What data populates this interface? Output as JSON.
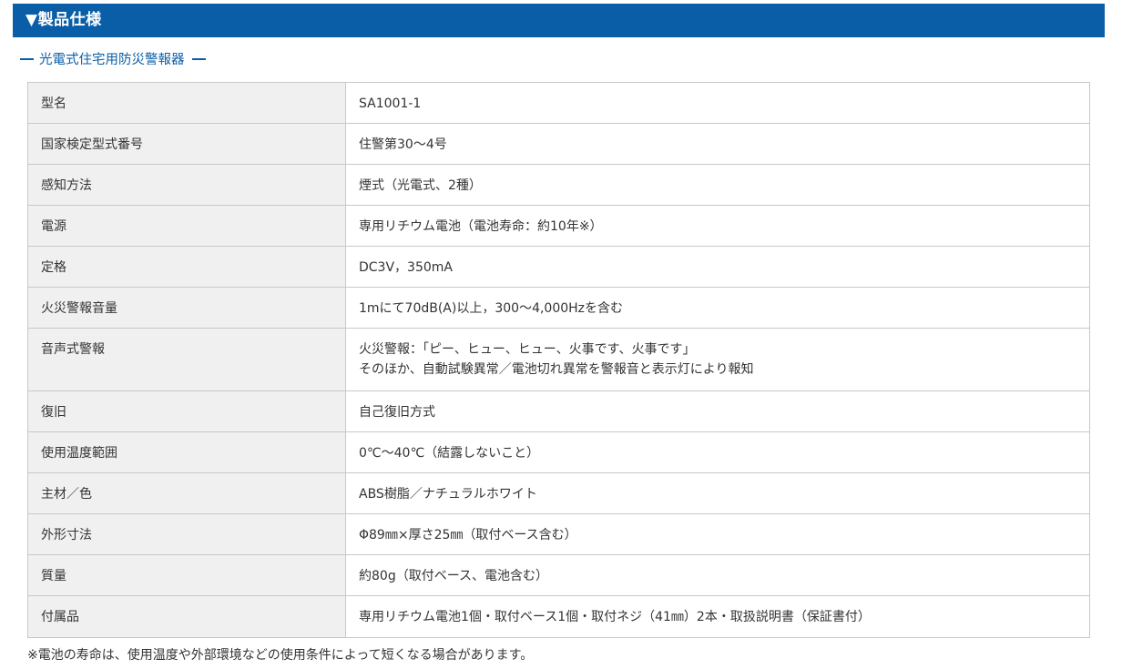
{
  "header": {
    "title": "▼製品仕様"
  },
  "section": {
    "title": "光電式住宅用防災警報器"
  },
  "spec_rows": [
    {
      "label": "型名",
      "value": [
        "SA1001-1"
      ]
    },
    {
      "label": "国家検定型式番号",
      "value": [
        "住警第30～4号"
      ]
    },
    {
      "label": "感知方法",
      "value": [
        "煙式（光電式、2種）"
      ]
    },
    {
      "label": "電源",
      "value": [
        "専用リチウム電池（電池寿命：約10年※）"
      ]
    },
    {
      "label": "定格",
      "value": [
        "DC3V，350mA"
      ]
    },
    {
      "label": "火災警報音量",
      "value": [
        "1mにて70dB(A)以上，300～4,000Hzを含む"
      ]
    },
    {
      "label": "音声式警報",
      "value": [
        "火災警報：「ピー、ヒュー、ヒュー、火事です、火事です」",
        "そのほか、自動試験異常／電池切れ異常を警報音と表示灯により報知"
      ]
    },
    {
      "label": "復旧",
      "value": [
        "自己復旧方式"
      ]
    },
    {
      "label": "使用温度範囲",
      "value": [
        "0℃～40℃（結露しないこと）"
      ]
    },
    {
      "label": "主材／色",
      "value": [
        "ABS樹脂／ナチュラルホワイト"
      ]
    },
    {
      "label": "外形寸法",
      "value": [
        "Φ89㎜×厚さ25㎜（取付ベース含む）"
      ]
    },
    {
      "label": "質量",
      "value": [
        "約80g（取付ベース、電池含む）"
      ]
    },
    {
      "label": "付属品",
      "value": [
        "専用リチウム電池1個・取付ベース1個・取付ネジ（41㎜）2本・取扱説明書（保証書付）"
      ]
    }
  ],
  "footnote": "※電池の寿命は、使用温度や外部環境などの使用条件によって短くなる場合があります。"
}
